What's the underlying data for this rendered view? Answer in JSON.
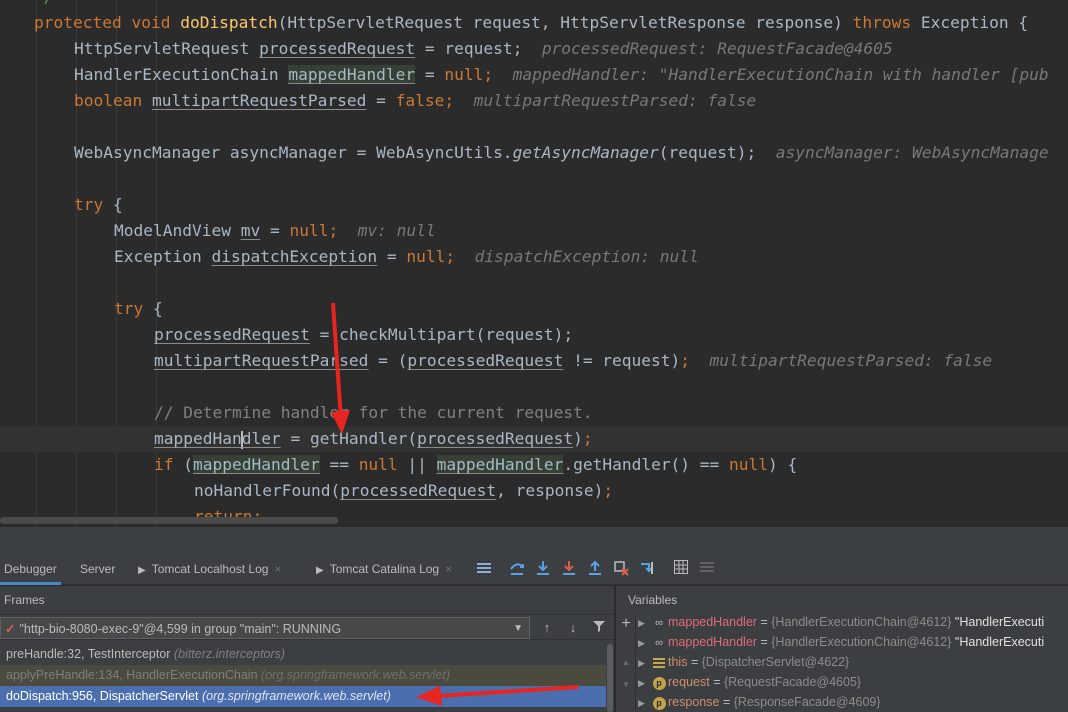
{
  "editor": {
    "top_fragment": "*/",
    "lines": {
      "l1": {
        "kw1": "protected",
        "kw2": "void",
        "fn": "doDispatch",
        "sig": "(HttpServletRequest request, HttpServletResponse response) ",
        "kw3": "throws",
        "rest": " Exception {"
      },
      "l2": {
        "type": "HttpServletRequest ",
        "var": "processedRequest",
        "rest": " = request;",
        "hint": "processedRequest: RequestFacade@4605"
      },
      "l3": {
        "type": "HandlerExecutionChain ",
        "var": "mappedHandler",
        "eq": " = ",
        "kw": "null",
        "semi": ";",
        "hint": "mappedHandler: \"HandlerExecutionChain with handler [pub"
      },
      "l4": {
        "kw": "boolean",
        "var": "multipartRequestParsed",
        "eq": " = ",
        "kw2": "false",
        "semi": ";",
        "hint": "multipartRequestParsed: false"
      },
      "l5": {
        "pre": "WebAsyncManager asyncManager = WebAsyncUtils.",
        "it": "getAsyncManager",
        "post": "(request);",
        "hint": "asyncManager: WebAsyncManage"
      },
      "l6": {
        "kw": "try",
        "rest": " {"
      },
      "l7": {
        "type": "ModelAndView ",
        "var": "mv",
        "eq": " = ",
        "kw": "null",
        "semi": ";",
        "hint": "mv: null"
      },
      "l8": {
        "type": "Exception ",
        "var": "dispatchException",
        "eq": " = ",
        "kw": "null",
        "semi": ";",
        "hint": "dispatchException: null"
      },
      "l9": {
        "kw": "try",
        "rest": " {"
      },
      "l10": {
        "var": "processedRequest",
        "rest": " = checkMultipart(request);"
      },
      "l11": {
        "var": "multipartRequestParsed",
        "mid": " = (",
        "var2": "processedRequest",
        "rest": " != request)",
        "semi": ";",
        "hint": "multipartRequestParsed: false"
      },
      "l12": {
        "comment": "// Determine handler for the current request."
      },
      "l13": {
        "var_a": "mappedHan",
        "var_b": "dler",
        "mid": " = getHandler",
        "p1": "(",
        "var2": "processedRequest",
        "p2": ")",
        "semi": ";"
      },
      "l14": {
        "kw": "if",
        "p1": " (",
        "var": "mappedHandler",
        "mid": " == ",
        "kw2": "null",
        "or": " || ",
        "var2": "mappedHandler",
        "mid2": ".getHandler() == ",
        "kw3": "null",
        "rest": ") {"
      },
      "l15": {
        "pre": "noHandlerFound",
        "p1": "(",
        "var": "processedRequest",
        "rest": ", response)",
        "semi": ";"
      },
      "l16": {
        "kw": "return",
        "semi": ";"
      }
    }
  },
  "debugger": {
    "tabs": [
      "Debugger",
      "Server",
      "Tomcat Localhost Log",
      "Tomcat Catalina Log"
    ],
    "frames_title": "Frames",
    "variables_title": "Variables",
    "thread": "\"http-bio-8080-exec-9\"@4,599 in group \"main\": RUNNING",
    "frames": [
      {
        "method": "preHandle:32, TestInterceptor",
        "pkg": "(bitterz.interceptors)"
      },
      {
        "method": "applyPreHandle:134, HandlerExecutionChain",
        "pkg": "(org.springframework.web.servlet)"
      },
      {
        "method": "doDispatch:956, DispatcherServlet",
        "pkg": "(org.springframework.web.servlet)"
      }
    ],
    "variables": [
      {
        "name": "mappedHandler",
        "type": "{HandlerExecutionChain@4612}",
        "value": "\"HandlerExecuti",
        "icon": "watch-icon"
      },
      {
        "name": "mappedHandler",
        "type": "{HandlerExecutionChain@4612}",
        "value": "\"HandlerExecuti",
        "icon": "watch-icon"
      },
      {
        "name": "this",
        "type": "{DispatcherServlet@4622}",
        "value": "",
        "icon": "field-icon"
      },
      {
        "name": "request",
        "type": "{RequestFacade@4605}",
        "value": "",
        "icon": "param-icon"
      },
      {
        "name": "response",
        "type": "{ResponseFacade@4609}",
        "value": "",
        "icon": "param-icon"
      }
    ]
  },
  "colors": {
    "accent": "#4b6eaf",
    "annotation_arrow": "#e8251f",
    "keyword": "#cc7832",
    "function": "#ffc66d"
  }
}
